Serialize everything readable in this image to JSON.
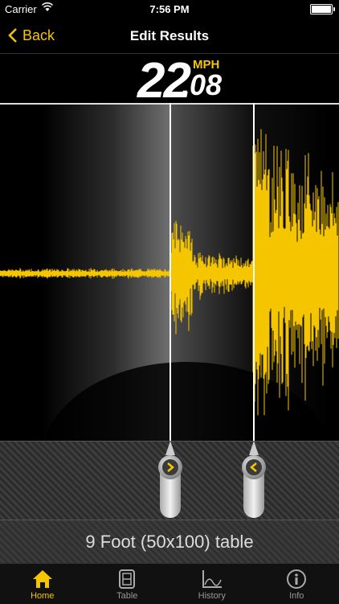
{
  "status_bar": {
    "carrier": "Carrier",
    "time": "7:56 PM"
  },
  "nav": {
    "back_label": "Back",
    "title": "Edit Results"
  },
  "speed": {
    "integer": "22",
    "decimal": ".08",
    "unit": "MPH"
  },
  "table_label": "9 Foot (50x100) table",
  "tabs": [
    {
      "label": "Home",
      "icon": "home-icon",
      "active": true
    },
    {
      "label": "Table",
      "icon": "table-icon",
      "active": false
    },
    {
      "label": "History",
      "icon": "history-chart-icon",
      "active": false
    },
    {
      "label": "Info",
      "icon": "info-icon",
      "active": false
    }
  ],
  "colors": {
    "accent": "#f5c600",
    "background": "#000000"
  }
}
